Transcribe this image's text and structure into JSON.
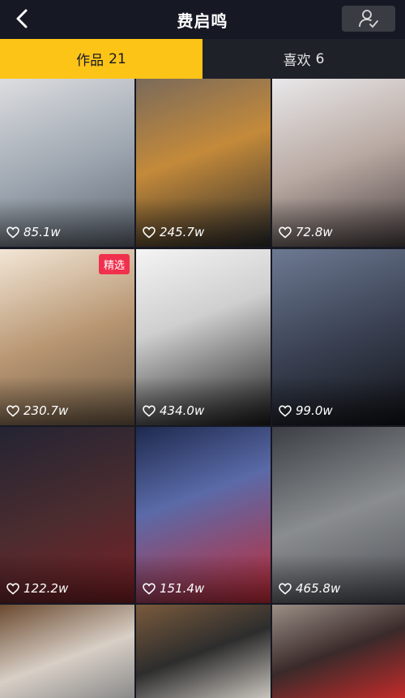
{
  "header": {
    "title": "费启鸣",
    "back_icon": "chevron-left-icon",
    "profile_icon": "user-check-icon"
  },
  "tabs": [
    {
      "label": "作品",
      "count": "21",
      "active": true
    },
    {
      "label": "喜欢",
      "count": "6",
      "active": false
    }
  ],
  "accent_color": "#fdc418",
  "videos": [
    {
      "likes": "85.1w"
    },
    {
      "likes": "245.7w"
    },
    {
      "likes": "72.8w"
    },
    {
      "likes": "230.7w",
      "badge": "精选"
    },
    {
      "likes": "434.0w"
    },
    {
      "likes": "99.0w"
    },
    {
      "likes": "122.2w"
    },
    {
      "likes": "151.4w"
    },
    {
      "likes": "465.8w"
    },
    {
      "likes": ""
    },
    {
      "likes": ""
    },
    {
      "likes": ""
    }
  ]
}
